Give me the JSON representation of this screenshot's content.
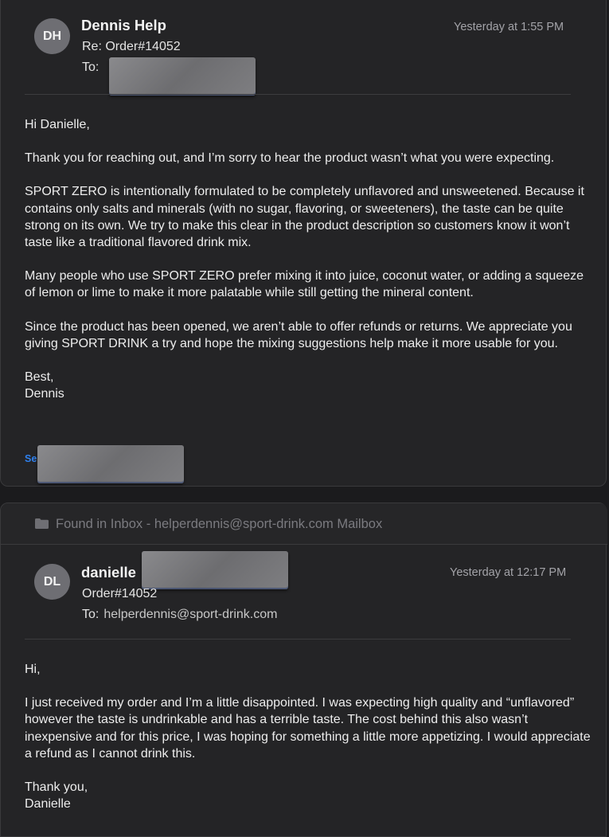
{
  "reply": {
    "avatar_initials": "DH",
    "sender_name": "Dennis Help",
    "subject": "Re: Order#14052",
    "to_label": "To:",
    "timestamp": "Yesterday at 1:55 PM",
    "body": {
      "greeting": "Hi Danielle,",
      "p1": "Thank you for reaching out, and I’m sorry to hear the product wasn’t what you were expecting.",
      "p2": "SPORT ZERO is intentionally formulated to be completely unflavored and unsweetened. Because it contains only salts and minerals (with no sugar, flavoring, or sweeteners), the taste can be quite strong on its own. We try to make this clear in the product description so customers know it won’t taste like a traditional flavored drink mix.",
      "p3": "Many people who use SPORT ZERO prefer mixing it into juice, coconut water, or adding a squeeze of lemon or lime to make it more palatable while still getting the mineral content.",
      "p4": "Since the product has been opened, we aren’t able to offer refunds or returns. We appreciate you giving SPORT DRINK a try and hope the mixing suggestions help make it more usable for you.",
      "signoff": "Best,",
      "signature_name": "Dennis",
      "signature_link": "Se"
    }
  },
  "found_in": {
    "icon": "folder-icon",
    "text": "Found in Inbox - helperdennis@sport-drink.com Mailbox"
  },
  "original": {
    "avatar_initials": "DL",
    "sender_name": "danielle",
    "subject": "Order#14052",
    "to_label": "To:",
    "to_address": "helperdennis@sport-drink.com",
    "timestamp": "Yesterday at 12:17 PM",
    "body": {
      "greeting": "Hi,",
      "p1": "I just received my order and I’m a little disappointed. I was expecting high quality and “unflavored” however the taste is undrinkable and has a terrible taste. The cost behind this also wasn’t inexpensive and for this price, I was hoping for something a little more appetizing. I would appreciate a refund as I cannot drink this.",
      "signoff": "Thank you,",
      "signature_name": "Danielle"
    }
  },
  "colors": {
    "background": "#1b1b1d",
    "card": "#242426",
    "avatar": "#6e6e73",
    "link": "#2f80ed",
    "redaction": "#7a7a7d"
  }
}
